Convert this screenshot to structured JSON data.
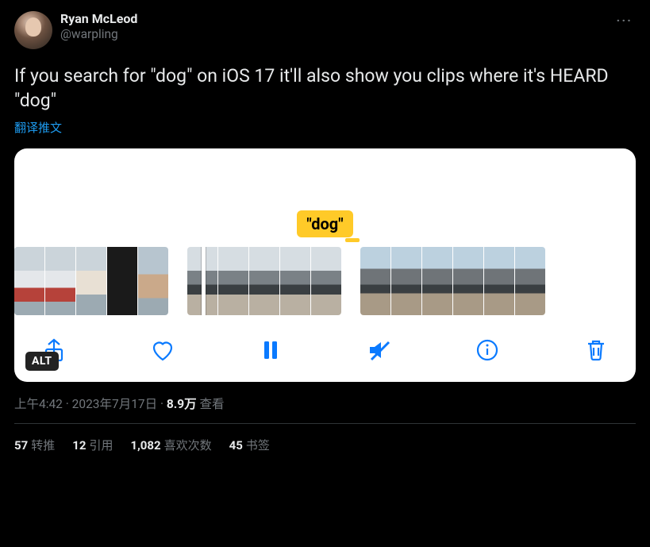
{
  "author": {
    "display_name": "Ryan McLeod",
    "handle": "@warpling"
  },
  "more_glyph": "···",
  "tweet_text": "If you search for \"dog\" on iOS 17 it'll also show you clips where it's HEARD \"dog\"",
  "translate_label": "翻译推文",
  "media": {
    "alt_badge": "ALT",
    "search_tag": "\"dog\"",
    "toolbar": {
      "share": "share-icon",
      "like": "heart-icon",
      "pause": "pause-icon",
      "mute": "mute-icon",
      "info": "info-icon",
      "trash": "trash-icon"
    }
  },
  "meta": {
    "time": "上午4:42",
    "sep1": " · ",
    "date": "2023年7月17日",
    "sep2": " · ",
    "views_num": "8.9万",
    "views_label": " 查看"
  },
  "stats": {
    "retweets_num": "57",
    "retweets_label": "转推",
    "quotes_num": "12",
    "quotes_label": "引用",
    "likes_num": "1,082",
    "likes_label": "喜欢次数",
    "bookmarks_num": "45",
    "bookmarks_label": "书签"
  }
}
